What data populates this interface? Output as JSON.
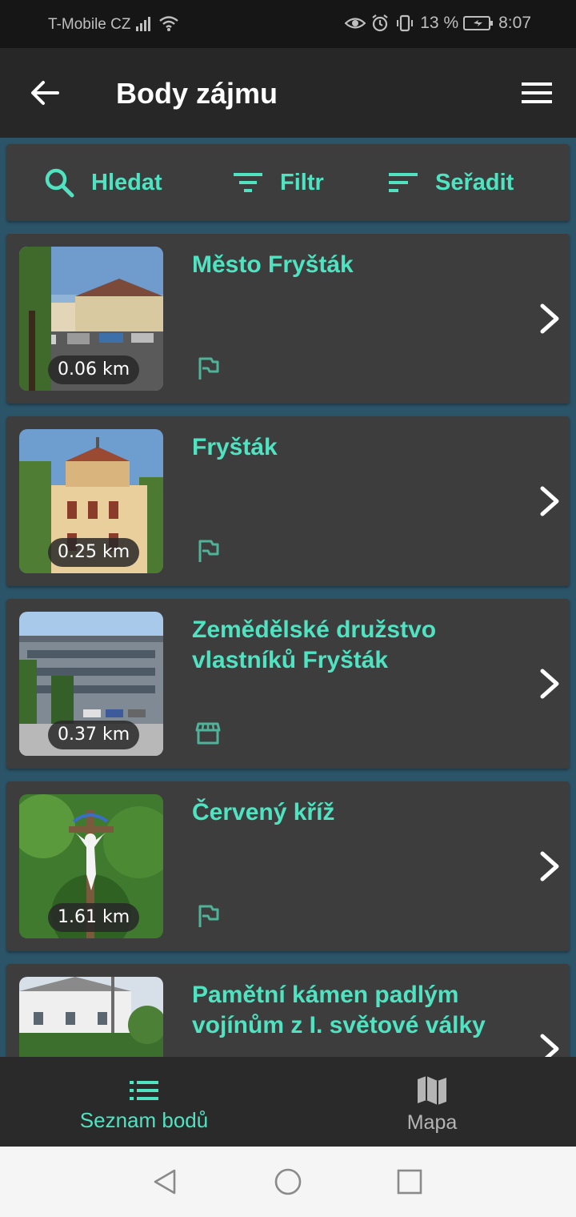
{
  "status": {
    "carrier": "T-Mobile CZ",
    "battery": "13 %",
    "time": "8:07"
  },
  "header": {
    "title": "Body zájmu",
    "back_icon": "arrow-left-icon",
    "menu_icon": "hamburger-menu-icon"
  },
  "toolbar": {
    "search_label": "Hledat",
    "filter_label": "Filtr",
    "sort_label": "Seřadit"
  },
  "points": [
    {
      "title": "Město Fryšták",
      "distance": "0.06 km",
      "category_icon": "flag-icon"
    },
    {
      "title": "Fryšták",
      "distance": "0.25 km",
      "category_icon": "flag-icon"
    },
    {
      "title": "Zemědělské družstvo vlastníků Fryšták",
      "distance": "0.37 km",
      "category_icon": "store-icon"
    },
    {
      "title": "Červený kříž",
      "distance": "1.61 km",
      "category_icon": "flag-icon"
    },
    {
      "title": "Pamětní kámen padlým vojínům z I. světové války",
      "distance": "",
      "category_icon": "flag-icon"
    }
  ],
  "bottom_nav": {
    "list_label": "Seznam bodů",
    "map_label": "Mapa"
  },
  "colors": {
    "accent": "#4fe3c1",
    "card": "#3d3d3d",
    "background": "#2b5468",
    "appbar": "#272727"
  }
}
